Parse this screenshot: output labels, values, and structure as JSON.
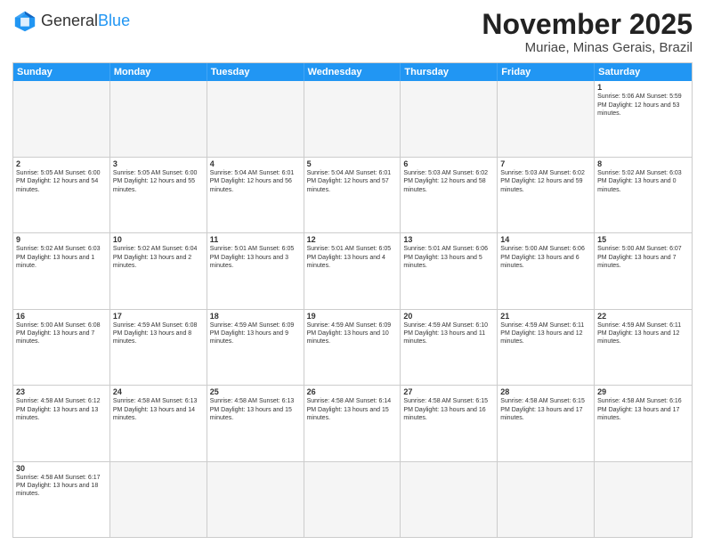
{
  "logo": {
    "text_general": "General",
    "text_blue": "Blue"
  },
  "title": "November 2025",
  "subtitle": "Muriae, Minas Gerais, Brazil",
  "header_days": [
    "Sunday",
    "Monday",
    "Tuesday",
    "Wednesday",
    "Thursday",
    "Friday",
    "Saturday"
  ],
  "weeks": [
    [
      {
        "day": "",
        "info": "",
        "empty": true
      },
      {
        "day": "",
        "info": "",
        "empty": true
      },
      {
        "day": "",
        "info": "",
        "empty": true
      },
      {
        "day": "",
        "info": "",
        "empty": true
      },
      {
        "day": "",
        "info": "",
        "empty": true
      },
      {
        "day": "",
        "info": "",
        "empty": true
      },
      {
        "day": "1",
        "info": "Sunrise: 5:06 AM\nSunset: 5:59 PM\nDaylight: 12 hours\nand 53 minutes.",
        "empty": false
      }
    ],
    [
      {
        "day": "2",
        "info": "Sunrise: 5:05 AM\nSunset: 6:00 PM\nDaylight: 12 hours\nand 54 minutes.",
        "empty": false
      },
      {
        "day": "3",
        "info": "Sunrise: 5:05 AM\nSunset: 6:00 PM\nDaylight: 12 hours\nand 55 minutes.",
        "empty": false
      },
      {
        "day": "4",
        "info": "Sunrise: 5:04 AM\nSunset: 6:01 PM\nDaylight: 12 hours\nand 56 minutes.",
        "empty": false
      },
      {
        "day": "5",
        "info": "Sunrise: 5:04 AM\nSunset: 6:01 PM\nDaylight: 12 hours\nand 57 minutes.",
        "empty": false
      },
      {
        "day": "6",
        "info": "Sunrise: 5:03 AM\nSunset: 6:02 PM\nDaylight: 12 hours\nand 58 minutes.",
        "empty": false
      },
      {
        "day": "7",
        "info": "Sunrise: 5:03 AM\nSunset: 6:02 PM\nDaylight: 12 hours\nand 59 minutes.",
        "empty": false
      },
      {
        "day": "8",
        "info": "Sunrise: 5:02 AM\nSunset: 6:03 PM\nDaylight: 13 hours\nand 0 minutes.",
        "empty": false
      }
    ],
    [
      {
        "day": "9",
        "info": "Sunrise: 5:02 AM\nSunset: 6:03 PM\nDaylight: 13 hours\nand 1 minute.",
        "empty": false
      },
      {
        "day": "10",
        "info": "Sunrise: 5:02 AM\nSunset: 6:04 PM\nDaylight: 13 hours\nand 2 minutes.",
        "empty": false
      },
      {
        "day": "11",
        "info": "Sunrise: 5:01 AM\nSunset: 6:05 PM\nDaylight: 13 hours\nand 3 minutes.",
        "empty": false
      },
      {
        "day": "12",
        "info": "Sunrise: 5:01 AM\nSunset: 6:05 PM\nDaylight: 13 hours\nand 4 minutes.",
        "empty": false
      },
      {
        "day": "13",
        "info": "Sunrise: 5:01 AM\nSunset: 6:06 PM\nDaylight: 13 hours\nand 5 minutes.",
        "empty": false
      },
      {
        "day": "14",
        "info": "Sunrise: 5:00 AM\nSunset: 6:06 PM\nDaylight: 13 hours\nand 6 minutes.",
        "empty": false
      },
      {
        "day": "15",
        "info": "Sunrise: 5:00 AM\nSunset: 6:07 PM\nDaylight: 13 hours\nand 7 minutes.",
        "empty": false
      }
    ],
    [
      {
        "day": "16",
        "info": "Sunrise: 5:00 AM\nSunset: 6:08 PM\nDaylight: 13 hours\nand 7 minutes.",
        "empty": false
      },
      {
        "day": "17",
        "info": "Sunrise: 4:59 AM\nSunset: 6:08 PM\nDaylight: 13 hours\nand 8 minutes.",
        "empty": false
      },
      {
        "day": "18",
        "info": "Sunrise: 4:59 AM\nSunset: 6:09 PM\nDaylight: 13 hours\nand 9 minutes.",
        "empty": false
      },
      {
        "day": "19",
        "info": "Sunrise: 4:59 AM\nSunset: 6:09 PM\nDaylight: 13 hours\nand 10 minutes.",
        "empty": false
      },
      {
        "day": "20",
        "info": "Sunrise: 4:59 AM\nSunset: 6:10 PM\nDaylight: 13 hours\nand 11 minutes.",
        "empty": false
      },
      {
        "day": "21",
        "info": "Sunrise: 4:59 AM\nSunset: 6:11 PM\nDaylight: 13 hours\nand 12 minutes.",
        "empty": false
      },
      {
        "day": "22",
        "info": "Sunrise: 4:59 AM\nSunset: 6:11 PM\nDaylight: 13 hours\nand 12 minutes.",
        "empty": false
      }
    ],
    [
      {
        "day": "23",
        "info": "Sunrise: 4:58 AM\nSunset: 6:12 PM\nDaylight: 13 hours\nand 13 minutes.",
        "empty": false
      },
      {
        "day": "24",
        "info": "Sunrise: 4:58 AM\nSunset: 6:13 PM\nDaylight: 13 hours\nand 14 minutes.",
        "empty": false
      },
      {
        "day": "25",
        "info": "Sunrise: 4:58 AM\nSunset: 6:13 PM\nDaylight: 13 hours\nand 15 minutes.",
        "empty": false
      },
      {
        "day": "26",
        "info": "Sunrise: 4:58 AM\nSunset: 6:14 PM\nDaylight: 13 hours\nand 15 minutes.",
        "empty": false
      },
      {
        "day": "27",
        "info": "Sunrise: 4:58 AM\nSunset: 6:15 PM\nDaylight: 13 hours\nand 16 minutes.",
        "empty": false
      },
      {
        "day": "28",
        "info": "Sunrise: 4:58 AM\nSunset: 6:15 PM\nDaylight: 13 hours\nand 17 minutes.",
        "empty": false
      },
      {
        "day": "29",
        "info": "Sunrise: 4:58 AM\nSunset: 6:16 PM\nDaylight: 13 hours\nand 17 minutes.",
        "empty": false
      }
    ],
    [
      {
        "day": "30",
        "info": "Sunrise: 4:58 AM\nSunset: 6:17 PM\nDaylight: 13 hours\nand 18 minutes.",
        "empty": false
      },
      {
        "day": "",
        "info": "",
        "empty": true
      },
      {
        "day": "",
        "info": "",
        "empty": true
      },
      {
        "day": "",
        "info": "",
        "empty": true
      },
      {
        "day": "",
        "info": "",
        "empty": true
      },
      {
        "day": "",
        "info": "",
        "empty": true
      },
      {
        "day": "",
        "info": "",
        "empty": true
      }
    ]
  ]
}
